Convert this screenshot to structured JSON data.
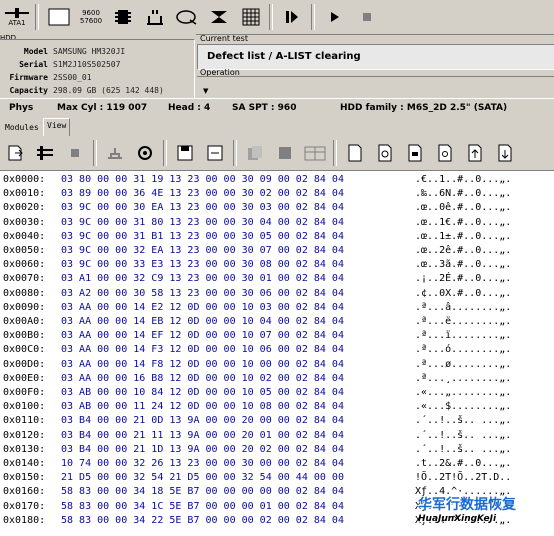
{
  "toolbar": {
    "ata_label": "ATA1",
    "btn_960_a": "9600",
    "btn_960_b": "57600"
  },
  "hdd": {
    "title": "HDD",
    "rows": [
      {
        "key": "Model",
        "value": "SAMSUNG HM320JI"
      },
      {
        "key": "Serial",
        "value": "S1M2J10S502507"
      },
      {
        "key": "Firmware",
        "value": "2SS00_01"
      },
      {
        "key": "Capacity",
        "value": "298.09 GB (625 142 448)"
      }
    ]
  },
  "current_test": {
    "title": "Current test",
    "value": "Defect list / A-LIST clearing"
  },
  "operation": {
    "title": "Operation"
  },
  "status": {
    "phys": "Phys",
    "max_cyl": "Max Cyl : 119 007",
    "head": "Head : 4",
    "sa_spt": "SA SPT : 960",
    "family": "HDD family : M6S_2D 2.5\" (SATA)"
  },
  "tabs": [
    {
      "label": "Modules"
    },
    {
      "label": "View"
    }
  ],
  "hex_rows": [
    {
      "addr": "0x0000:",
      "bytes": "03 80 00 00 31 19 13 23 00 00 30 09 00 02 84 04",
      "ascii": ".€..1..#..0...„."
    },
    {
      "addr": "0x0010:",
      "bytes": "03 89 00 00 36 4E 13 23 00 00 30 02 00 02 84 04",
      "ascii": ".‰..6N.#..0...„."
    },
    {
      "addr": "0x0020:",
      "bytes": "03 9C 00 00 30 EA 13 23 00 00 30 03 00 02 84 04",
      "ascii": ".œ..0ê.#..0...„."
    },
    {
      "addr": "0x0030:",
      "bytes": "03 9C 00 00 31 80 13 23 00 00 30 04 00 02 84 04",
      "ascii": ".œ..1€.#..0...„."
    },
    {
      "addr": "0x0040:",
      "bytes": "03 9C 00 00 31 B1 13 23 00 00 30 05 00 02 84 04",
      "ascii": ".œ..1±.#..0...„."
    },
    {
      "addr": "0x0050:",
      "bytes": "03 9C 00 00 32 EA 13 23 00 00 30 07 00 02 84 04",
      "ascii": ".œ..2ê.#..0...„."
    },
    {
      "addr": "0x0060:",
      "bytes": "03 9C 00 00 33 E3 13 23 00 00 30 08 00 02 84 04",
      "ascii": ".œ..3ã.#..0...„."
    },
    {
      "addr": "0x0070:",
      "bytes": "03 A1 00 00 32 C9 13 23 00 00 30 01 00 02 84 04",
      "ascii": ".¡..2É.#..0...„."
    },
    {
      "addr": "0x0080:",
      "bytes": "03 A2 00 00 30 58 13 23 00 00 30 06 00 02 84 04",
      "ascii": ".¢..0X.#..0...„."
    },
    {
      "addr": "0x0090:",
      "bytes": "03 AA 00 00 14 E2 12 0D 00 00 10 03 00 02 84 04",
      "ascii": ".ª...â........„."
    },
    {
      "addr": "0x00A0:",
      "bytes": "03 AA 00 00 14 EB 12 0D 00 00 10 04 00 02 84 04",
      "ascii": ".ª...ë........„."
    },
    {
      "addr": "0x00B0:",
      "bytes": "03 AA 00 00 14 EF 12 0D 00 00 10 07 00 02 84 04",
      "ascii": ".ª...ï........„."
    },
    {
      "addr": "0x00C0:",
      "bytes": "03 AA 00 00 14 F3 12 0D 00 00 10 06 00 02 84 04",
      "ascii": ".ª...ó........„."
    },
    {
      "addr": "0x00D0:",
      "bytes": "03 AA 00 00 14 F8 12 0D 00 00 10 00 00 02 84 04",
      "ascii": ".ª...ø........„."
    },
    {
      "addr": "0x00E0:",
      "bytes": "03 AA 00 00 16 B8 12 0D 00 00 10 02 00 02 84 04",
      "ascii": ".ª...¸........„."
    },
    {
      "addr": "0x00F0:",
      "bytes": "03 AB 00 00 10 84 12 0D 00 00 10 05 00 02 84 04",
      "ascii": ".«...„........„."
    },
    {
      "addr": "0x0100:",
      "bytes": "03 AB 00 00 11 24 12 0D 00 00 10 08 00 02 84 04",
      "ascii": ".«...$........„."
    },
    {
      "addr": "0x0110:",
      "bytes": "03 B4 00 00 21 0D 13 9A 00 00 20 00 00 02 84 04",
      "ascii": ".´..!..š.. ...„."
    },
    {
      "addr": "0x0120:",
      "bytes": "03 B4 00 00 21 11 13 9A 00 00 20 01 00 02 84 04",
      "ascii": ".´..!..š.. ...„."
    },
    {
      "addr": "0x0130:",
      "bytes": "03 B4 00 00 21 1D 13 9A 00 00 20 02 00 02 84 04",
      "ascii": ".´..!..š.. ...„."
    },
    {
      "addr": "0x0140:",
      "bytes": "10 74 00 00 32 26 13 23 00 00 30 00 00 02 84 04",
      "ascii": ".t..2&.#..0...„."
    },
    {
      "addr": "0x0150:",
      "bytes": "21 D5 00 00 32 54 21 D5 00 00 32 54 00 44 00 00",
      "ascii": "!Õ..2T!Õ..2T.D.."
    },
    {
      "addr": "0x0160:",
      "bytes": "58 83 00 00 34 18 5E B7 00 00 00 00 00 02 84 04",
      "ascii": "Xƒ..4.^·......„."
    },
    {
      "addr": "0x0170:",
      "bytes": "58 83 00 00 34 1C 5E B7 00 00 00 01 00 02 84 04",
      "ascii": "Xƒ..4.^·......„."
    },
    {
      "addr": "0x0180:",
      "bytes": "58 83 00 00 34 22 5E B7 00 00 00 02 00 02 84 04",
      "ascii": "Xƒ..4\"^·......„."
    }
  ],
  "watermark": {
    "line1": "华军行数据恢复",
    "line2": "HuaJunXingKeJi"
  },
  "icons": {
    "toolbar1": [
      "ata-icon",
      "card-960-icon",
      "chip-icon",
      "plug-icon",
      "disk-icon",
      "platter-icon",
      "grid-icon",
      "step-icon",
      "play-icon",
      "stop-icon"
    ],
    "toolbar2": [
      "export-icon",
      "settings-icon",
      "stop-icon",
      "remove-icon",
      "config-icon",
      "save-icon",
      "save-all-icon",
      "copy-icon",
      "paste-icon",
      "table-icon",
      "doc-icon",
      "doc-gear-icon",
      "doc-chip-icon",
      "doc-search-icon",
      "page-up-icon",
      "page-down-icon"
    ]
  }
}
